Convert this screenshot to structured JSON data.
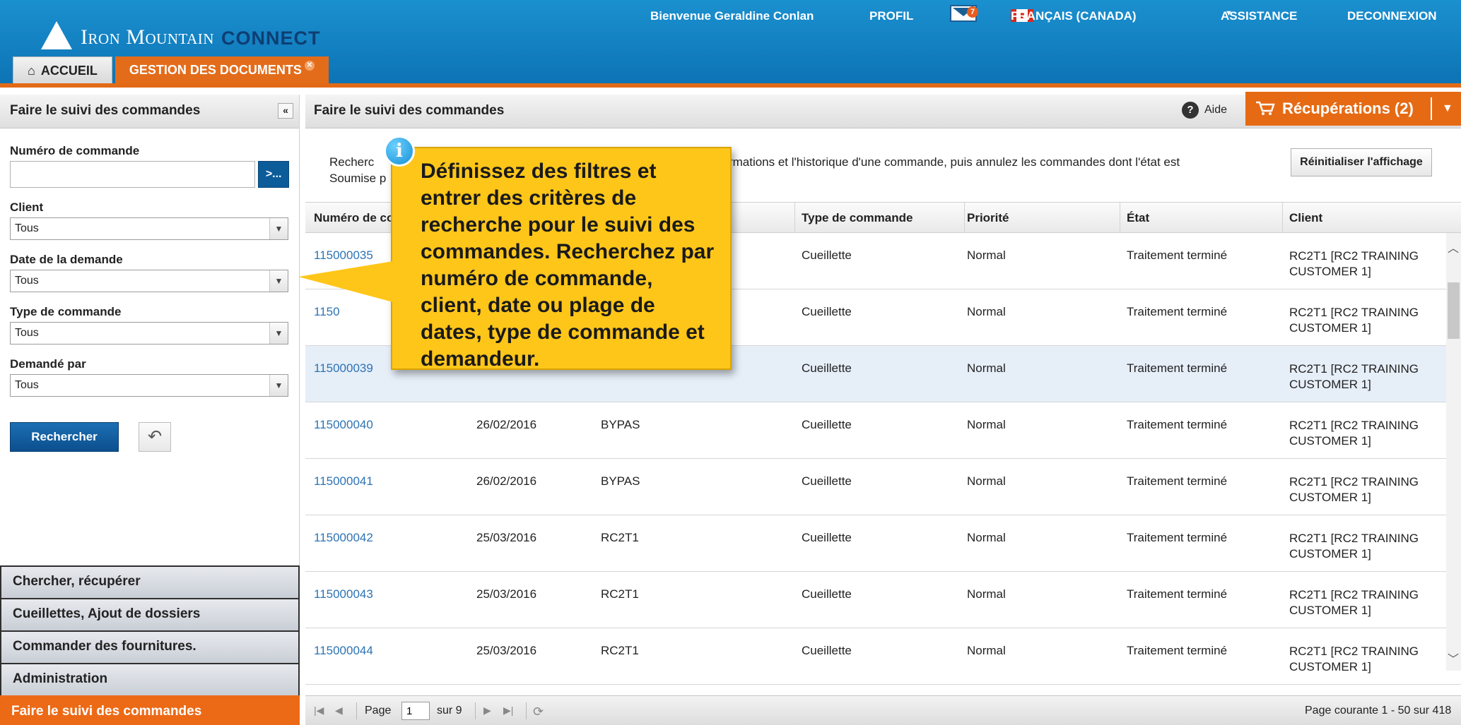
{
  "header": {
    "brand": "Iron Mountain",
    "brand_sub": "CONNECT",
    "welcome": "Bienvenue Geraldine Conlan",
    "profile": "PROFIL",
    "messages_count": "7",
    "language": "FRANÇAIS (CANADA)",
    "assistance": "ASSISTANCE",
    "logout": "DECONNEXION",
    "tabs": [
      {
        "label": "ACCUEIL"
      },
      {
        "label": "GESTION DES DOCUMENTS"
      }
    ]
  },
  "sidebar": {
    "title": "Faire le suivi des commandes",
    "collapse": "«",
    "fields": {
      "order_number_label": "Numéro de commande",
      "order_number_value": "",
      "go_label": ">...",
      "client_label": "Client",
      "client_value": "Tous",
      "date_label": "Date de la demande",
      "date_value": "Tous",
      "type_label": "Type de commande",
      "type_value": "Tous",
      "requested_by_label": "Demandé par",
      "requested_by_value": "Tous"
    },
    "search_button": "Rechercher",
    "nav": [
      {
        "label": "Chercher, récupérer"
      },
      {
        "label": "Cueillettes, Ajout de dossiers"
      },
      {
        "label": "Commander des fournitures."
      },
      {
        "label": "Administration"
      },
      {
        "label": "Faire le suivi des commandes"
      }
    ]
  },
  "main": {
    "title": "Faire le suivi des commandes",
    "help": "Aide",
    "retrievals": "Récupérations (2)",
    "description_line1": "Recherc",
    "description_line1b": "nformations et l'historique d'une commande, puis annulez les commandes dont l'état est",
    "description_line2": "Soumise p",
    "reset_display": "Réinitialiser l'affichage",
    "columns": [
      "Numéro de co",
      "Type de commande",
      "Priorité",
      "État",
      "Client"
    ],
    "rows": [
      {
        "order": "115000035",
        "date": "",
        "by": "",
        "type": "Cueillette",
        "priority": "Normal",
        "state": "Traitement terminé",
        "client1": "RC2T1 [RC2 TRAINING",
        "client2": "CUSTOMER 1]"
      },
      {
        "order": "1150",
        "date": "",
        "by": "",
        "type": "Cueillette",
        "priority": "Normal",
        "state": "Traitement terminé",
        "client1": "RC2T1 [RC2 TRAINING",
        "client2": "CUSTOMER 1]"
      },
      {
        "order": "115000039",
        "date": "",
        "by": "",
        "type": "Cueillette",
        "priority": "Normal",
        "state": "Traitement terminé",
        "client1": "RC2T1 [RC2 TRAINING",
        "client2": "CUSTOMER 1]"
      },
      {
        "order": "115000040",
        "date": "26/02/2016",
        "by": "BYPAS",
        "type": "Cueillette",
        "priority": "Normal",
        "state": "Traitement terminé",
        "client1": "RC2T1 [RC2 TRAINING",
        "client2": "CUSTOMER 1]"
      },
      {
        "order": "115000041",
        "date": "26/02/2016",
        "by": "BYPAS",
        "type": "Cueillette",
        "priority": "Normal",
        "state": "Traitement terminé",
        "client1": "RC2T1 [RC2 TRAINING",
        "client2": "CUSTOMER 1]"
      },
      {
        "order": "115000042",
        "date": "25/03/2016",
        "by": "RC2T1",
        "type": "Cueillette",
        "priority": "Normal",
        "state": "Traitement terminé",
        "client1": "RC2T1 [RC2 TRAINING",
        "client2": "CUSTOMER 1]"
      },
      {
        "order": "115000043",
        "date": "25/03/2016",
        "by": "RC2T1",
        "type": "Cueillette",
        "priority": "Normal",
        "state": "Traitement terminé",
        "client1": "RC2T1 [RC2 TRAINING",
        "client2": "CUSTOMER 1]"
      },
      {
        "order": "115000044",
        "date": "25/03/2016",
        "by": "RC2T1",
        "type": "Cueillette",
        "priority": "Normal",
        "state": "Traitement terminé",
        "client1": "RC2T1 [RC2 TRAINING",
        "client2": "CUSTOMER 1]"
      }
    ],
    "pager": {
      "page_label": "Page",
      "page_value": "1",
      "of_label": "sur 9",
      "current": "Page courante 1 - 50 sur 418"
    }
  },
  "callout": {
    "text": "Définissez des filtres et entrer des critères de recherche pour le suivi des commandes. Recherchez par numéro de commande, client, date ou plage de dates, type de commande et demandeur.",
    "icon": "i"
  },
  "colors": {
    "header_blue": "#1b90cf",
    "accent_orange": "#e36c1a",
    "callout_yellow": "#ffc61a",
    "link_blue": "#2d73b4"
  }
}
